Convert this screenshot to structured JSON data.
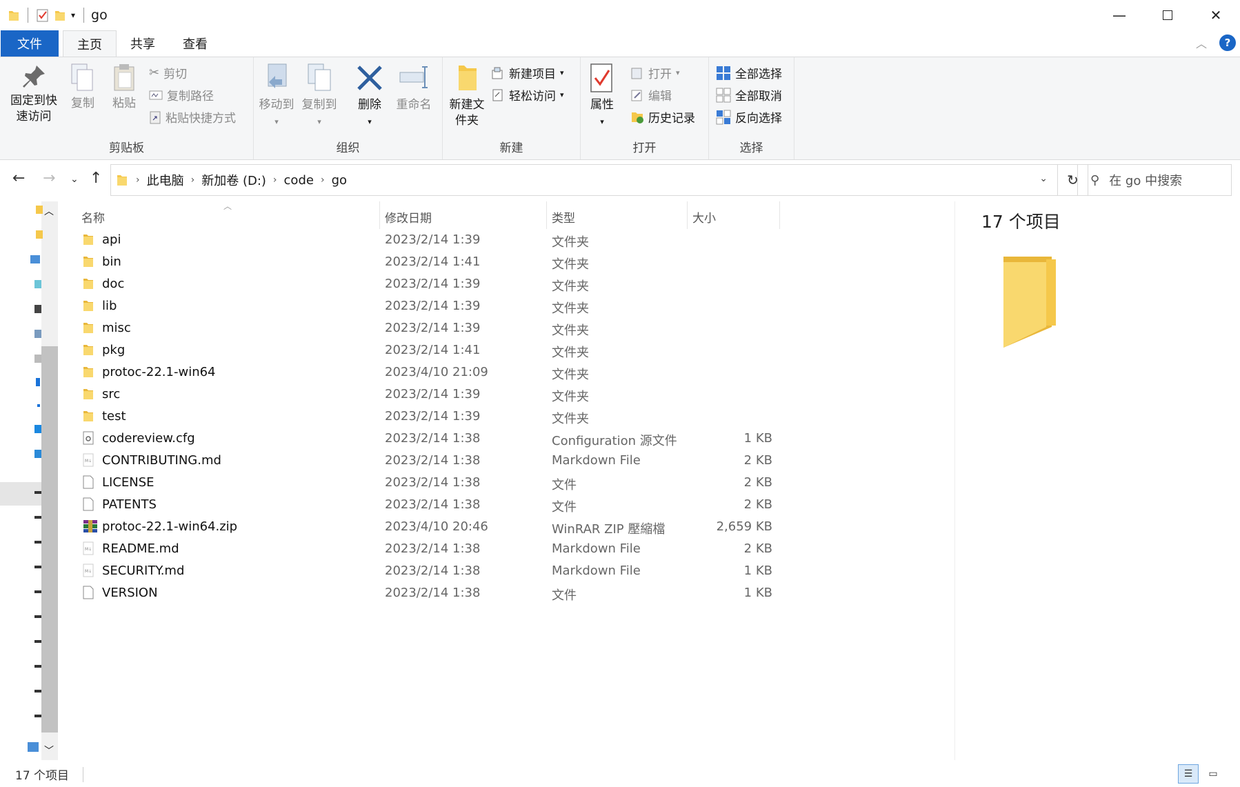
{
  "window": {
    "title": "go"
  },
  "tabs": {
    "file": "文件",
    "home": "主页",
    "share": "共享",
    "view": "查看"
  },
  "ribbon": {
    "clipboard": {
      "label": "剪贴板",
      "pin": "固定到快速访问",
      "copy": "复制",
      "paste": "粘贴",
      "cut": "剪切",
      "copy_path": "复制路径",
      "paste_shortcut": "粘贴快捷方式"
    },
    "organize": {
      "label": "组织",
      "move_to": "移动到",
      "copy_to": "复制到",
      "delete": "删除",
      "rename": "重命名"
    },
    "new": {
      "label": "新建",
      "new_folder": "新建文件夹",
      "new_item": "新建项目",
      "easy_access": "轻松访问"
    },
    "open": {
      "label": "打开",
      "properties": "属性",
      "open": "打开",
      "edit": "编辑",
      "history": "历史记录"
    },
    "select": {
      "label": "选择",
      "select_all": "全部选择",
      "select_none": "全部取消",
      "invert": "反向选择"
    }
  },
  "address": {
    "crumbs": [
      "此电脑",
      "新加卷 (D:)",
      "code",
      "go"
    ],
    "search_placeholder": "在 go 中搜索"
  },
  "columns": {
    "name": "名称",
    "date": "修改日期",
    "type": "类型",
    "size": "大小"
  },
  "files": [
    {
      "name": "api",
      "date": "2023/2/14 1:39",
      "type": "文件夹",
      "size": "",
      "icon": "folder-icon"
    },
    {
      "name": "bin",
      "date": "2023/2/14 1:41",
      "type": "文件夹",
      "size": "",
      "icon": "folder-icon"
    },
    {
      "name": "doc",
      "date": "2023/2/14 1:39",
      "type": "文件夹",
      "size": "",
      "icon": "folder-icon"
    },
    {
      "name": "lib",
      "date": "2023/2/14 1:39",
      "type": "文件夹",
      "size": "",
      "icon": "folder-icon"
    },
    {
      "name": "misc",
      "date": "2023/2/14 1:39",
      "type": "文件夹",
      "size": "",
      "icon": "folder-icon"
    },
    {
      "name": "pkg",
      "date": "2023/2/14 1:41",
      "type": "文件夹",
      "size": "",
      "icon": "folder-icon"
    },
    {
      "name": "protoc-22.1-win64",
      "date": "2023/4/10 21:09",
      "type": "文件夹",
      "size": "",
      "icon": "folder-icon"
    },
    {
      "name": "src",
      "date": "2023/2/14 1:39",
      "type": "文件夹",
      "size": "",
      "icon": "folder-icon"
    },
    {
      "name": "test",
      "date": "2023/2/14 1:39",
      "type": "文件夹",
      "size": "",
      "icon": "folder-icon"
    },
    {
      "name": "codereview.cfg",
      "date": "2023/2/14 1:38",
      "type": "Configuration 源文件",
      "size": "1 KB",
      "icon": "config-file-icon"
    },
    {
      "name": "CONTRIBUTING.md",
      "date": "2023/2/14 1:38",
      "type": "Markdown File",
      "size": "2 KB",
      "icon": "markdown-file-icon"
    },
    {
      "name": "LICENSE",
      "date": "2023/2/14 1:38",
      "type": "文件",
      "size": "2 KB",
      "icon": "blank-file-icon"
    },
    {
      "name": "PATENTS",
      "date": "2023/2/14 1:38",
      "type": "文件",
      "size": "2 KB",
      "icon": "blank-file-icon"
    },
    {
      "name": "protoc-22.1-win64.zip",
      "date": "2023/4/10 20:46",
      "type": "WinRAR ZIP 壓縮檔",
      "size": "2,659 KB",
      "icon": "winrar-archive-icon"
    },
    {
      "name": "README.md",
      "date": "2023/2/14 1:38",
      "type": "Markdown File",
      "size": "2 KB",
      "icon": "markdown-file-icon"
    },
    {
      "name": "SECURITY.md",
      "date": "2023/2/14 1:38",
      "type": "Markdown File",
      "size": "1 KB",
      "icon": "markdown-file-icon"
    },
    {
      "name": "VERSION",
      "date": "2023/2/14 1:38",
      "type": "文件",
      "size": "1 KB",
      "icon": "blank-file-icon"
    }
  ],
  "preview": {
    "count": "17 个项目"
  },
  "status": {
    "count": "17 个项目"
  },
  "colors": {
    "accent": "#1a66c6",
    "folder": "#f5c84b",
    "ribbon_bg": "#f5f6f7"
  }
}
